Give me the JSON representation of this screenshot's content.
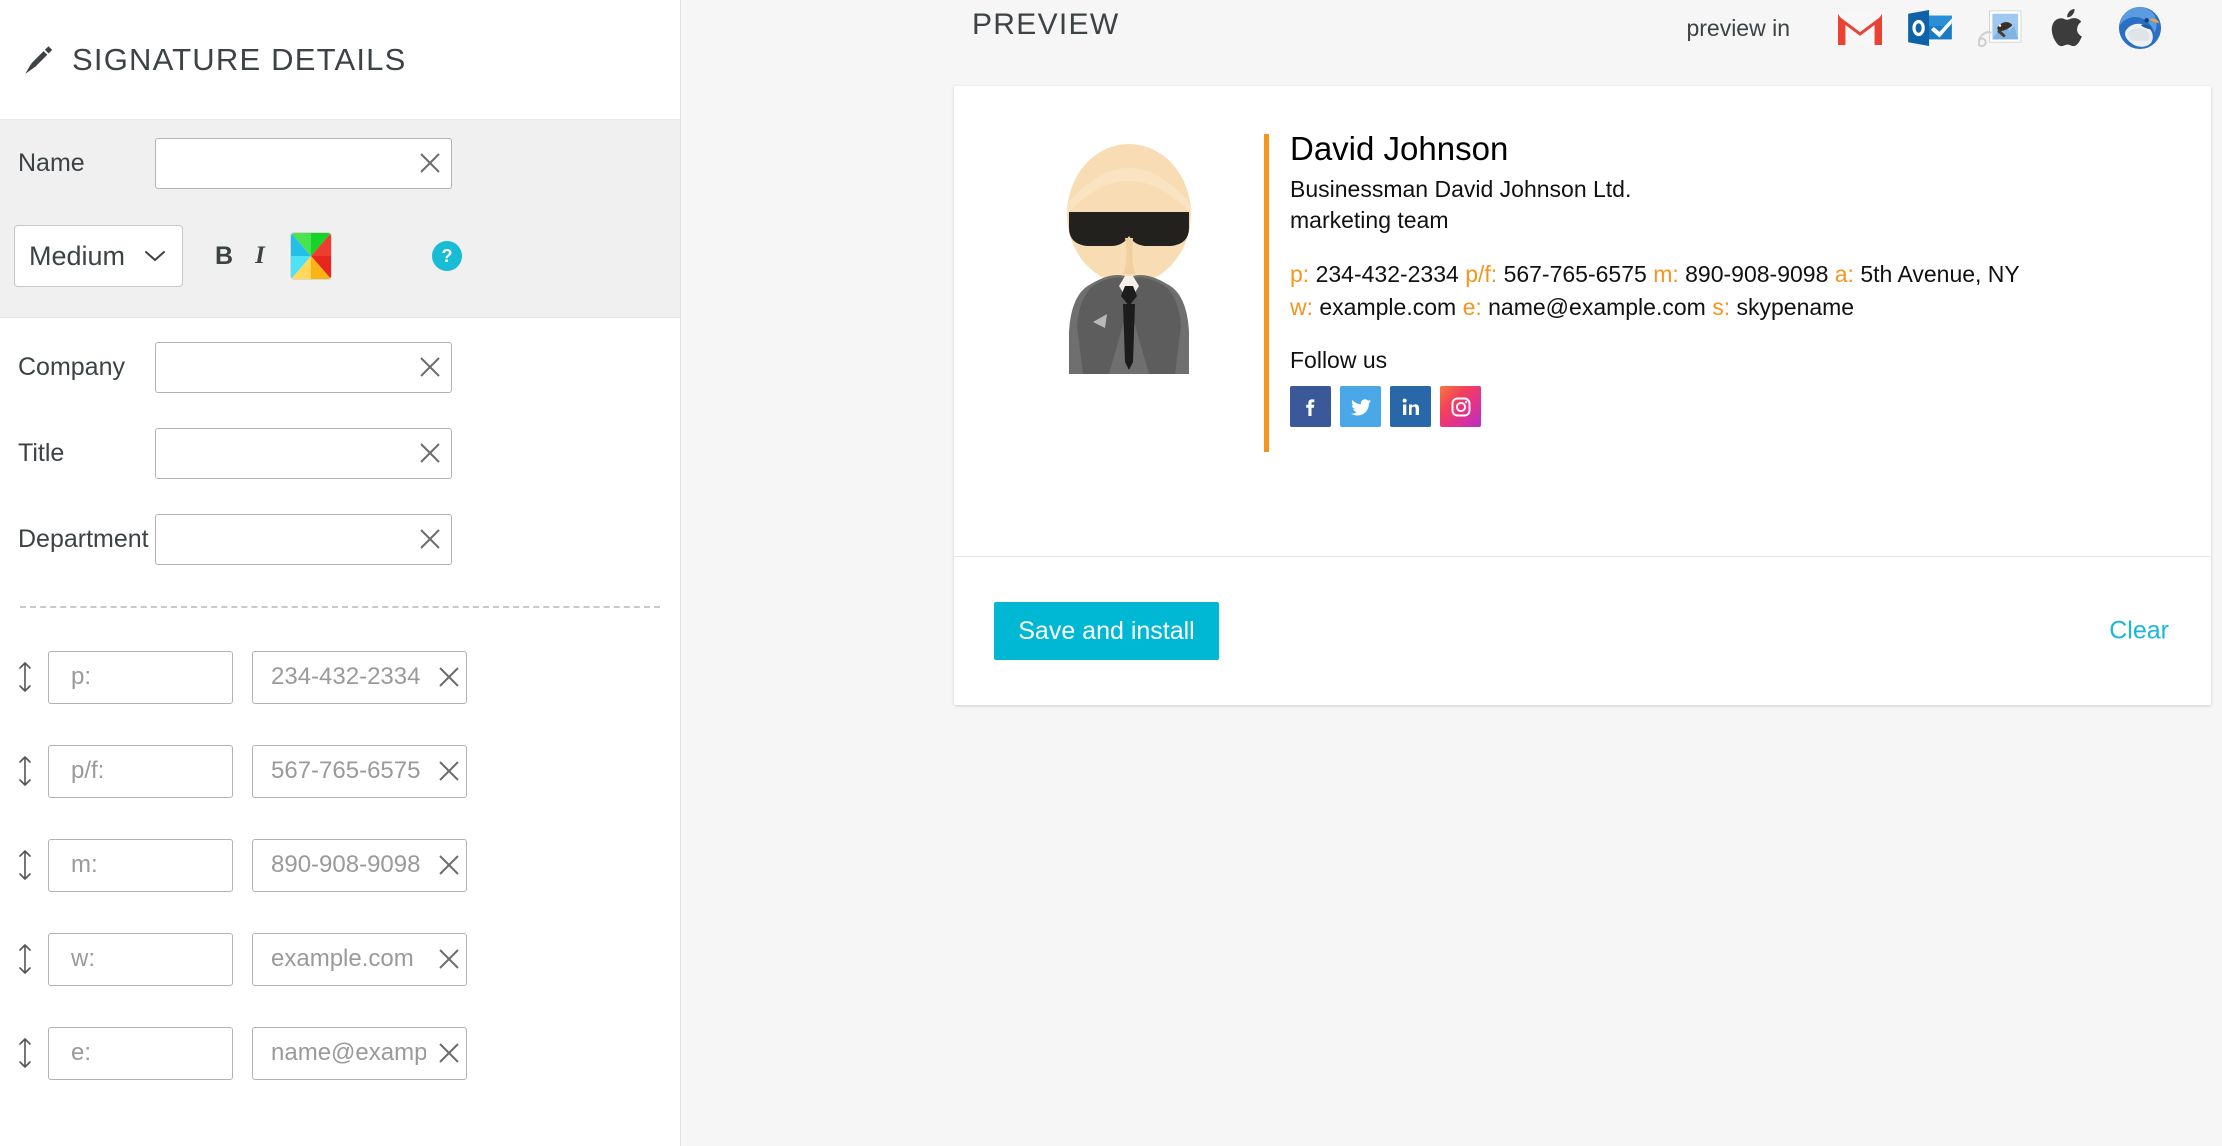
{
  "left_panel": {
    "header": {
      "icon": "pen-nib-icon",
      "title": "SIGNATURE DETAILS"
    },
    "fields": [
      {
        "label": "Name",
        "value": "",
        "placeholder": "",
        "clear_icon": "close-icon"
      },
      {
        "label": "Company",
        "value": "",
        "placeholder": "",
        "clear_icon": "close-icon"
      },
      {
        "label": "Title",
        "value": "",
        "placeholder": "",
        "clear_icon": "close-icon"
      },
      {
        "label": "Department",
        "value": "",
        "placeholder": "",
        "clear_icon": "close-icon"
      }
    ],
    "toolbar": {
      "size_value": "Medium",
      "size_options": [
        "Medium"
      ],
      "chevron_icon": "chevron-down-icon",
      "bold_label": "B",
      "italic_label": "I",
      "color_swatch_icon": "color-picker-icon",
      "help_label": "?",
      "help_icon": "question-mark-icon",
      "help_color": "#18bcd4"
    },
    "contact_rows": [
      {
        "handle_icon": "drag-vertical-icon",
        "key_placeholder": "p:",
        "value_placeholder": "234-432-2334",
        "clear_icon": "close-icon"
      },
      {
        "handle_icon": "drag-vertical-icon",
        "key_placeholder": "p/f:",
        "value_placeholder": "567-765-6575",
        "clear_icon": "close-icon"
      },
      {
        "handle_icon": "drag-vertical-icon",
        "key_placeholder": "m:",
        "value_placeholder": "890-908-9098",
        "clear_icon": "close-icon"
      },
      {
        "handle_icon": "drag-vertical-icon",
        "key_placeholder": "w:",
        "value_placeholder": "example.com",
        "clear_icon": "close-icon"
      },
      {
        "handle_icon": "drag-vertical-icon",
        "key_placeholder": "e:",
        "value_placeholder": "name@example.com",
        "clear_icon": "close-icon"
      }
    ]
  },
  "preview": {
    "title": "PREVIEW",
    "preview_in_label": "preview in",
    "clients": [
      {
        "name": "gmail-icon",
        "label": "Gmail"
      },
      {
        "name": "outlook-icon",
        "label": "Outlook"
      },
      {
        "name": "apple-mail-icon",
        "label": "Apple Mail"
      },
      {
        "name": "apple-icon",
        "label": "Apple"
      },
      {
        "name": "thunderbird-icon",
        "label": "Thunderbird"
      }
    ],
    "signature": {
      "avatar_icon": "businessman-avatar",
      "accent_color": "#f7941e",
      "name": "David Johnson",
      "role_line": "Businessman  David Johnson Ltd.",
      "department": "marketing team",
      "contacts_line1": [
        {
          "key": "p:",
          "value": "234-432-2334"
        },
        {
          "key": "p/f:",
          "value": "567-765-6575"
        },
        {
          "key": "m:",
          "value": "890-908-9098"
        },
        {
          "key": "a:",
          "value": "5th Avenue, NY"
        }
      ],
      "contacts_line2": [
        {
          "key": "w:",
          "value": "example.com"
        },
        {
          "key": "e:",
          "value": "name@example.com"
        },
        {
          "key": "s:",
          "value": "skypename"
        }
      ],
      "follow_label": "Follow us",
      "social": [
        {
          "name": "facebook-icon",
          "label": "Facebook",
          "color": "#3b5998"
        },
        {
          "name": "twitter-icon",
          "label": "Twitter",
          "color": "#4aa8e8"
        },
        {
          "name": "linkedin-icon",
          "label": "LinkedIn",
          "color": "#2867a8"
        },
        {
          "name": "instagram-icon",
          "label": "Instagram",
          "color": "#e4338a"
        }
      ]
    },
    "actions": {
      "save_label": "Save and install",
      "save_color": "#00b8d4",
      "clear_label": "Clear",
      "clear_color": "#19b7d9"
    }
  }
}
